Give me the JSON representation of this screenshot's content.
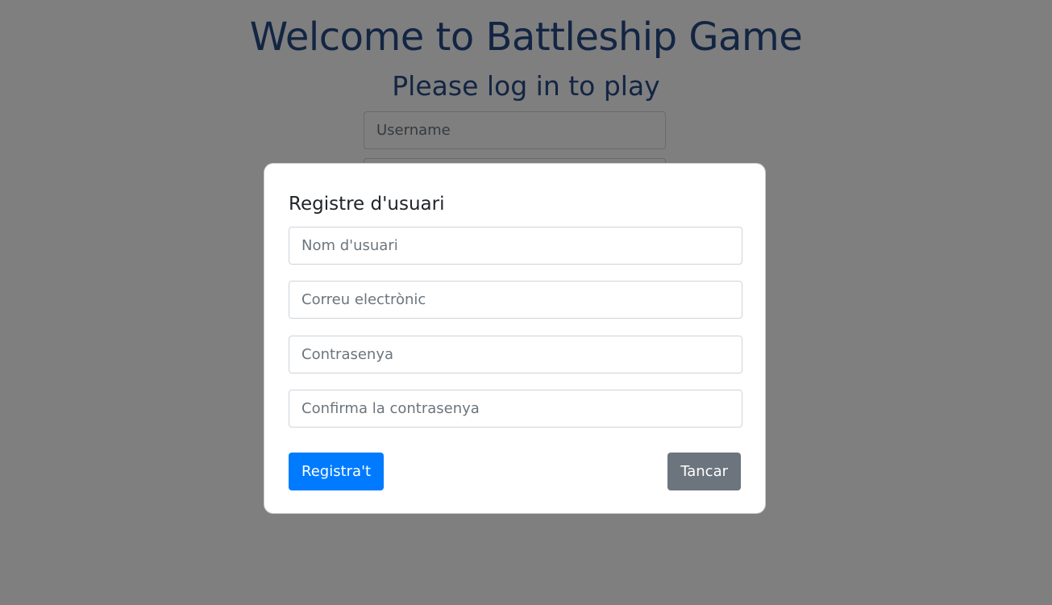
{
  "page": {
    "title": "Welcome to Battleship Game",
    "subtitle": "Please log in to play",
    "login": {
      "username_placeholder": "Username",
      "password_placeholder": ""
    }
  },
  "modal": {
    "title": "Registre d'usuari",
    "fields": {
      "username_placeholder": "Nom d'usuari",
      "email_placeholder": "Correu electrònic",
      "password_placeholder": "Contrasenya",
      "confirm_password_placeholder": "Confirma la contrasenya"
    },
    "register_label": "Registra't",
    "close_label": "Tancar"
  },
  "colors": {
    "heading": "#264b86",
    "primary": "#007bff",
    "secondary": "#6c757d",
    "backdrop": "rgba(0,0,0,0.5)"
  }
}
